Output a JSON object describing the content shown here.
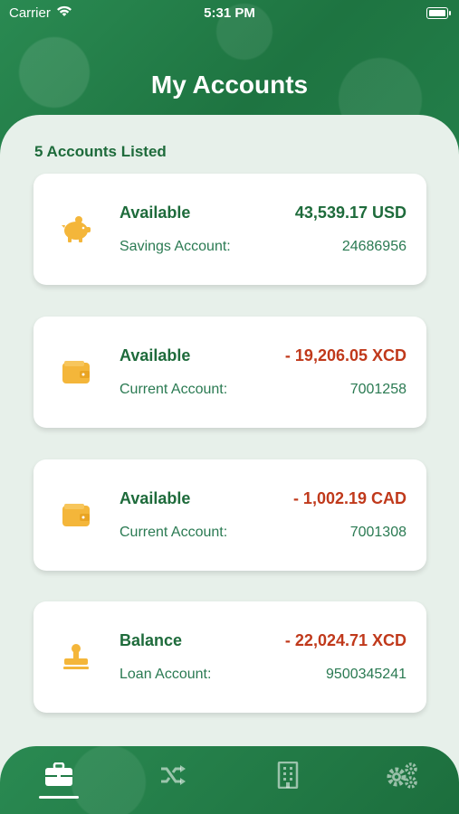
{
  "status_bar": {
    "carrier": "Carrier",
    "time": "5:31 PM"
  },
  "header": {
    "title": "My Accounts"
  },
  "summary": {
    "count_label": "5 Accounts Listed"
  },
  "colors": {
    "positive": "#1e6b3b",
    "negative": "#c0391b",
    "icon": "#f4b63a"
  },
  "accounts": [
    {
      "status": "Available",
      "amount": "43,539.17 USD",
      "type": "Savings Account:",
      "number": "24686956",
      "icon": "piggy-bank-icon"
    },
    {
      "status": "Available",
      "amount": "- 19,206.05 XCD",
      "type": "Current Account:",
      "number": "7001258",
      "icon": "wallet-icon"
    },
    {
      "status": "Available",
      "amount": "- 1,002.19 CAD",
      "type": "Current Account:",
      "number": "7001308",
      "icon": "wallet-icon"
    },
    {
      "status": "Balance",
      "amount": "- 22,024.71 XCD",
      "type": "Loan Account:",
      "number": "9500345241",
      "icon": "stamp-icon"
    }
  ],
  "tabs": [
    {
      "name": "accounts",
      "icon": "briefcase-icon",
      "active": true
    },
    {
      "name": "transfers",
      "icon": "shuffle-icon",
      "active": false
    },
    {
      "name": "branches",
      "icon": "building-icon",
      "active": false
    },
    {
      "name": "settings",
      "icon": "gears-icon",
      "active": false
    }
  ]
}
